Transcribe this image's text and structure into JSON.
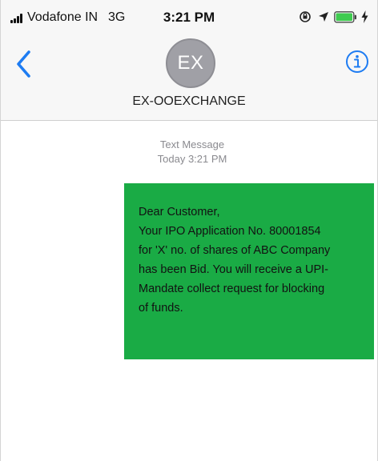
{
  "status_bar": {
    "carrier": "Vodafone IN",
    "network": "3G",
    "time": "3:21 PM"
  },
  "header": {
    "back_icon": "chevron-left-icon",
    "avatar_initials": "EX",
    "contact_name": "EX-OOEXCHANGE",
    "info_icon": "info-icon"
  },
  "messages": [
    {
      "meta": {
        "label": "Text Message",
        "timestamp": "Today 3:21 PM"
      },
      "text": "Dear Customer,\nYour IPO Application No. 80001854\nfor 'X' no. of shares of ABC Company\nhas been Bid. You will receive a UPI-\nMandate collect request for blocking\nof funds.",
      "bubble_color": "#1aab45"
    }
  ],
  "colors": {
    "accent": "#1e7cf2",
    "header_bg": "#f7f7f7",
    "avatar_bg": "#a0a0a6"
  }
}
